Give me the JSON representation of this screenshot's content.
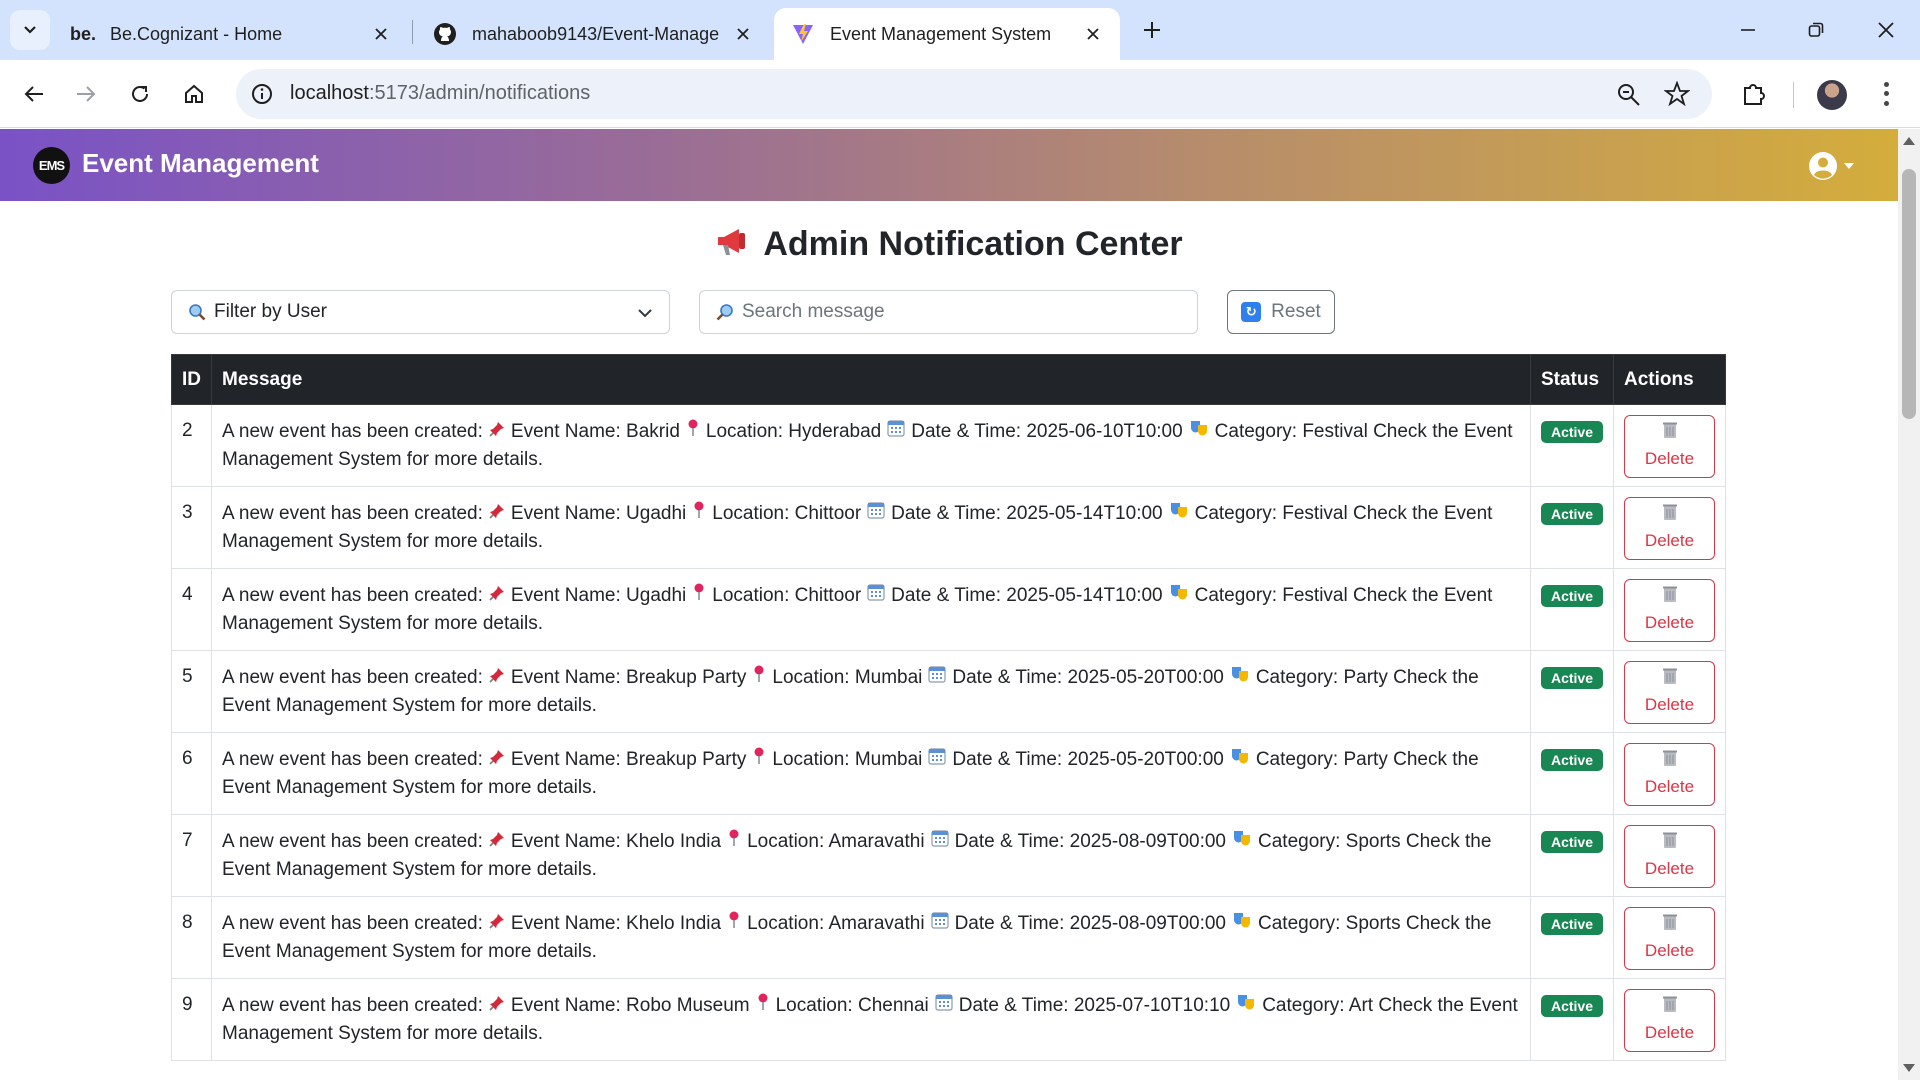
{
  "browser": {
    "tabs": [
      {
        "favicon": "be.",
        "title": "Be.Cognizant - Home",
        "active": false
      },
      {
        "favicon": "github-icon",
        "title": "mahaboob9143/Event-Manage",
        "active": false
      },
      {
        "favicon": "vite-icon",
        "title": "Event Management System",
        "active": true
      }
    ],
    "url_host": "localhost",
    "url_path": ":5173/admin/notifications"
  },
  "app": {
    "logo_text": "EMS",
    "brand_name": "Event Management"
  },
  "page": {
    "title": "Admin Notification Center",
    "filter_label": "Filter by User",
    "search_placeholder": "Search message",
    "reset_label": "Reset"
  },
  "table": {
    "columns": [
      "ID",
      "Message",
      "Status",
      "Actions"
    ],
    "delete_label": "Delete",
    "rows": [
      {
        "id": "2",
        "prefix": "A new event has been created:",
        "event": "Event Name: Bakrid",
        "location": "Location: Hyderabad",
        "datetime": "Date & Time: 2025-06-10T10:00",
        "category": "Category: Festival Check the",
        "tail": "Event Management System for more details.",
        "status": "Active"
      },
      {
        "id": "3",
        "prefix": "A new event has been created:",
        "event": "Event Name: Ugadhi",
        "location": "Location: Chittoor",
        "datetime": "Date & Time: 2025-05-14T10:00",
        "category": "Category: Festival Check the Event",
        "tail": "Management System for more details.",
        "status": "Active"
      },
      {
        "id": "4",
        "prefix": "A new event has been created:",
        "event": "Event Name: Ugadhi",
        "location": "Location: Chittoor",
        "datetime": "Date & Time: 2025-05-14T10:00",
        "category": "Category: Festival Check the Event",
        "tail": "Management System for more details.",
        "status": "Active"
      },
      {
        "id": "5",
        "prefix": "A new event has been created:",
        "event": "Event Name: Breakup Party",
        "location": "Location: Mumbai",
        "datetime": "Date & Time: 2025-05-20T00:00",
        "category": "Category: Party Check the",
        "tail": "Event Management System for more details.",
        "status": "Active"
      },
      {
        "id": "6",
        "prefix": "A new event has been created:",
        "event": "Event Name: Breakup Party",
        "location": "Location: Mumbai",
        "datetime": "Date & Time: 2025-05-20T00:00",
        "category": "Category: Party Check the",
        "tail": "Event Management System for more details.",
        "status": "Active"
      },
      {
        "id": "7",
        "prefix": "A new event has been created:",
        "event": "Event Name: Khelo India",
        "location": "Location: Amaravathi",
        "datetime": "Date & Time: 2025-08-09T00:00",
        "category": "Category: Sports Check the",
        "tail": "Event Management System for more details.",
        "status": "Active"
      },
      {
        "id": "8",
        "prefix": "A new event has been created:",
        "event": "Event Name: Khelo India",
        "location": "Location: Amaravathi",
        "datetime": "Date & Time: 2025-08-09T00:00",
        "category": "Category: Sports Check the",
        "tail": "Event Management System for more details.",
        "status": "Active"
      },
      {
        "id": "9",
        "prefix": "A new event has been created:",
        "event": "Event Name: Robo Museum",
        "location": "Location: Chennai",
        "datetime": "Date & Time: 2025-07-10T10:10",
        "category": "Category: Art Check the",
        "tail": "Event Management System for more details.",
        "status": "Active"
      }
    ]
  },
  "colors": {
    "header_gradient_start": "#7a52c6",
    "header_gradient_end": "#d4ad3c",
    "badge_active": "#198754",
    "delete": "#dc3545",
    "table_header": "#212529"
  },
  "icons": {
    "title": "megaphone-icon",
    "filter": "magnifier-icon",
    "search": "magnifier-icon",
    "reset": "refresh-icon",
    "event": "pushpin-icon",
    "location": "round-pin-icon",
    "datetime": "calendar-icon",
    "category": "performing-arts-icon",
    "delete": "wastebasket-icon"
  }
}
